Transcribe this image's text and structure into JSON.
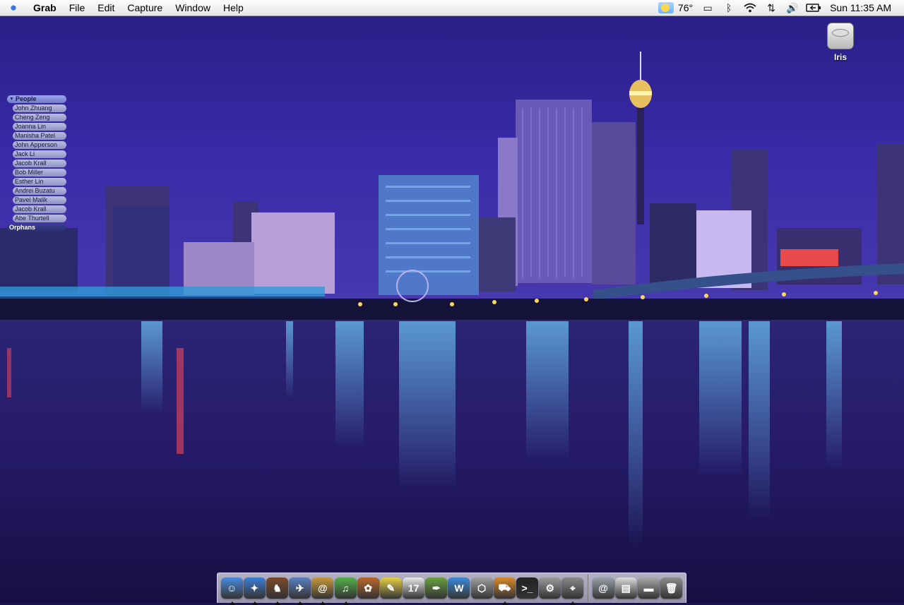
{
  "menubar": {
    "apple_icon": "apple-icon",
    "app_name": "Grab",
    "menus": [
      "File",
      "Edit",
      "Capture",
      "Window",
      "Help"
    ],
    "temperature": "76°",
    "status_icons": [
      "display-icon",
      "bluetooth-icon",
      "wifi-icon",
      "sync-icon",
      "volume-icon",
      "battery-icon"
    ],
    "clock": "Sun 11:35 AM"
  },
  "desktop": {
    "drive_label": "Iris",
    "drive_icon": "hard-drive-icon"
  },
  "people_widget": {
    "group_title": "People",
    "people": [
      "John Zhuang",
      "Cheng Zeng",
      "Joanna Lin",
      "Manisha Patel",
      "John Apperson",
      "Jack Li",
      "Jacob Krall",
      "Bob Miller",
      "Esther Lin",
      "Andrei Buzatu",
      "Pavel Malik",
      "Jacob Krall",
      "Abe Thurtell"
    ],
    "orphans_title": "Orphans"
  },
  "dock": {
    "apps": [
      {
        "name": "finder-icon",
        "color": "#4a8be0",
        "glyph": "☺",
        "running": true
      },
      {
        "name": "safari-icon",
        "color": "#3c7fd4",
        "glyph": "✦",
        "running": true
      },
      {
        "name": "chess-icon",
        "color": "#7a4a2a",
        "glyph": "♞",
        "running": true
      },
      {
        "name": "mail-icon",
        "color": "#5a7fc0",
        "glyph": "✈",
        "running": true
      },
      {
        "name": "address-book-icon",
        "color": "#c79a3c",
        "glyph": "@",
        "running": true
      },
      {
        "name": "itunes-icon",
        "color": "#55b04a",
        "glyph": "♫",
        "running": true
      },
      {
        "name": "iphoto-icon",
        "color": "#b8672c",
        "glyph": "✿",
        "running": false
      },
      {
        "name": "stickies-icon",
        "color": "#e6d24a",
        "glyph": "✎",
        "running": false
      },
      {
        "name": "ical-icon",
        "color": "#e8e8e8",
        "glyph": "17",
        "running": false
      },
      {
        "name": "textedit-icon",
        "color": "#6aa040",
        "glyph": "✒",
        "running": false
      },
      {
        "name": "word-icon",
        "color": "#3c8ad8",
        "glyph": "W",
        "running": false
      },
      {
        "name": "package-icon",
        "color": "#a0a0a0",
        "glyph": "⬡",
        "running": false
      },
      {
        "name": "transmit-icon",
        "color": "#d98a2a",
        "glyph": "⛟",
        "running": true
      },
      {
        "name": "terminal-icon",
        "color": "#222222",
        "glyph": ">_",
        "running": false
      },
      {
        "name": "system-prefs-icon",
        "color": "#9a9a9a",
        "glyph": "⚙",
        "running": false
      },
      {
        "name": "grab-icon",
        "color": "#8a8a8a",
        "glyph": "⌖",
        "running": true
      }
    ],
    "docs": [
      {
        "name": "internet-connect-icon",
        "color": "#9aa0aa",
        "glyph": "@"
      },
      {
        "name": "screenshot-doc-icon",
        "color": "#dcdcdc",
        "glyph": "▤"
      },
      {
        "name": "network-drive-icon",
        "color": "#a8a8a8",
        "glyph": "▬"
      },
      {
        "name": "trash-icon",
        "color": "#8c8c8c",
        "glyph": "🗑"
      }
    ]
  }
}
